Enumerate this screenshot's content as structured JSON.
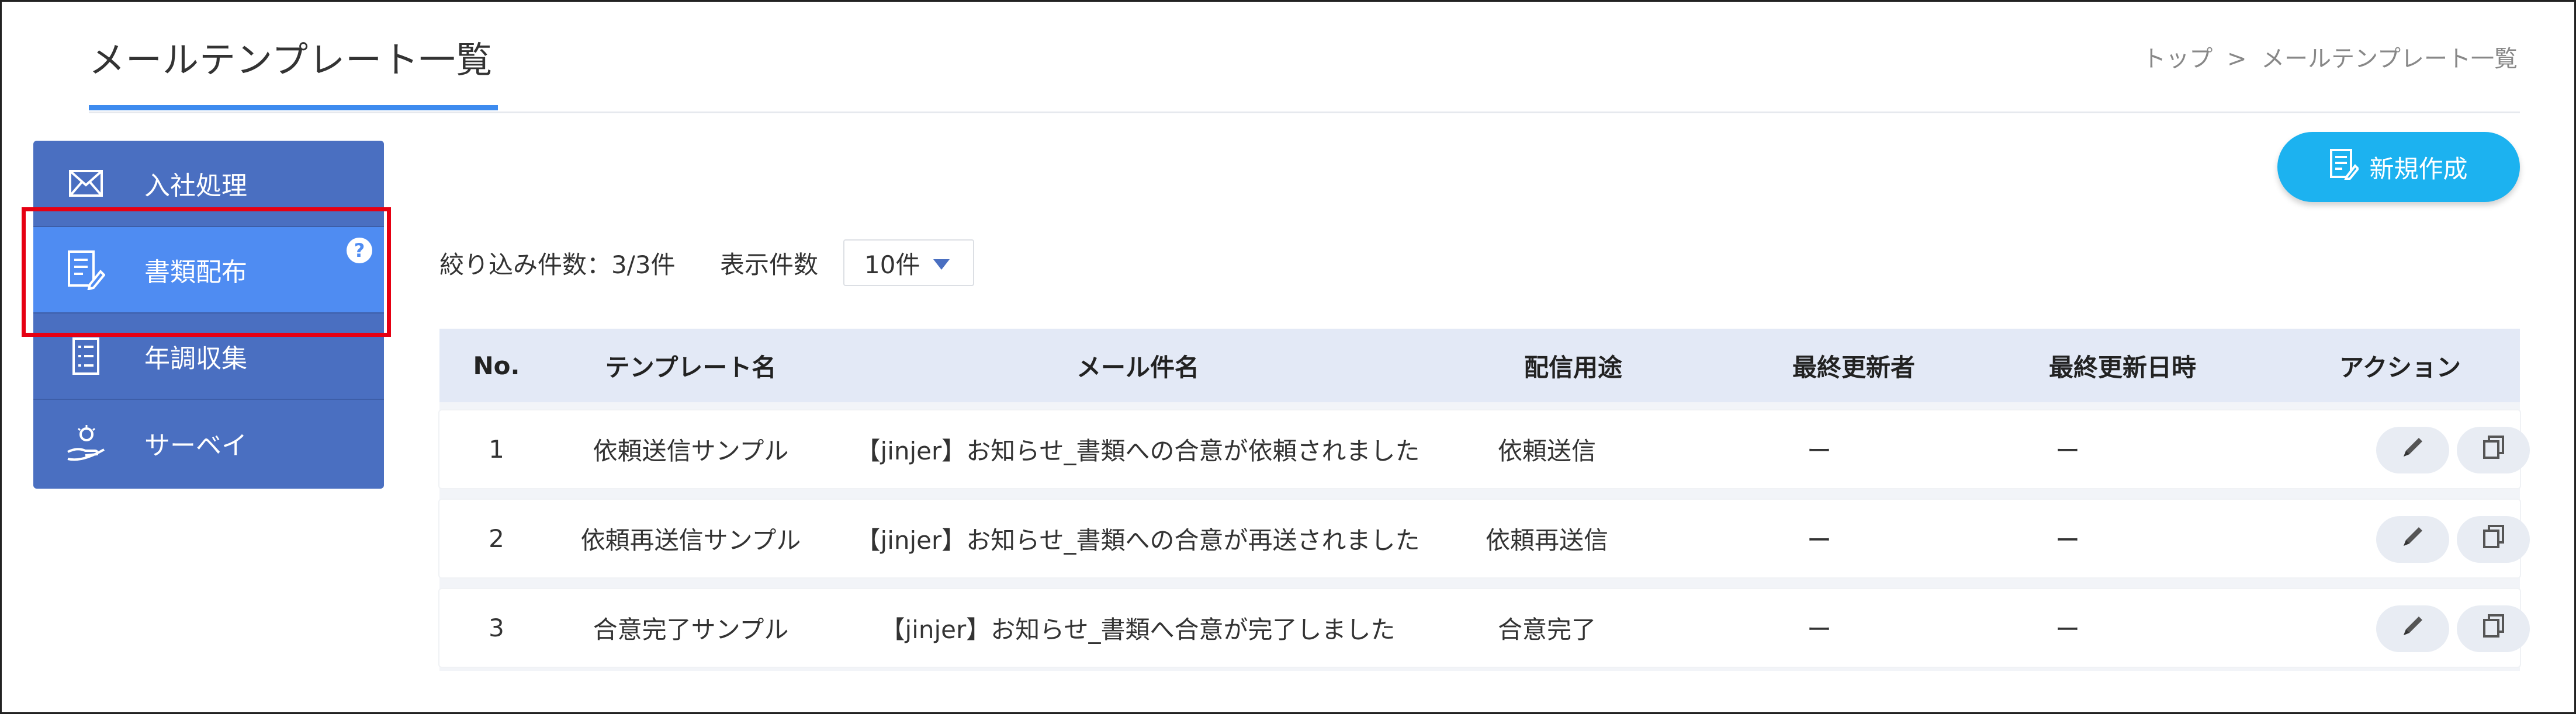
{
  "page": {
    "title": "メールテンプレート一覧"
  },
  "breadcrumb": {
    "home": "トップ",
    "separator": ">",
    "current": "メールテンプレート一覧"
  },
  "sidebar": {
    "items": [
      {
        "label": "入社処理",
        "icon": "envelope-icon",
        "active": false
      },
      {
        "label": "書類配布",
        "icon": "document-sign-icon",
        "active": true,
        "help": "?"
      },
      {
        "label": "年調収集",
        "icon": "checklist-icon",
        "active": false
      },
      {
        "label": "サーベイ",
        "icon": "survey-hand-icon",
        "active": false
      }
    ]
  },
  "toolbar": {
    "new_label": "新規作成",
    "filter_count": "絞り込み件数：3/3件",
    "display_label": "表示件数",
    "display_value": "10件"
  },
  "table": {
    "headers": {
      "no": "No.",
      "name": "テンプレート名",
      "subject": "メール件名",
      "use": "配信用途",
      "updater": "最終更新者",
      "updated_at": "最終更新日時",
      "action": "アクション"
    },
    "rows": [
      {
        "no": "1",
        "name": "依頼送信サンプル",
        "subject": "【jinjer】お知らせ_書類への合意が依頼されました",
        "use": "依頼送信",
        "updater": "ー",
        "updated_at": "ー"
      },
      {
        "no": "2",
        "name": "依頼再送信サンプル",
        "subject": "【jinjer】お知らせ_書類への合意が再送されました",
        "use": "依頼再送信",
        "updater": "ー",
        "updated_at": "ー"
      },
      {
        "no": "3",
        "name": "合意完了サンプル",
        "subject": "【jinjer】お知らせ_書類へ合意が完了しました",
        "use": "合意完了",
        "updater": "ー",
        "updated_at": "ー"
      }
    ]
  },
  "colors": {
    "accent": "#3d8bef",
    "sidebar": "#4a6fc1",
    "sidebar_active": "#4f8cf2",
    "new_button": "#1cb2f0",
    "highlight": "#e60012"
  }
}
